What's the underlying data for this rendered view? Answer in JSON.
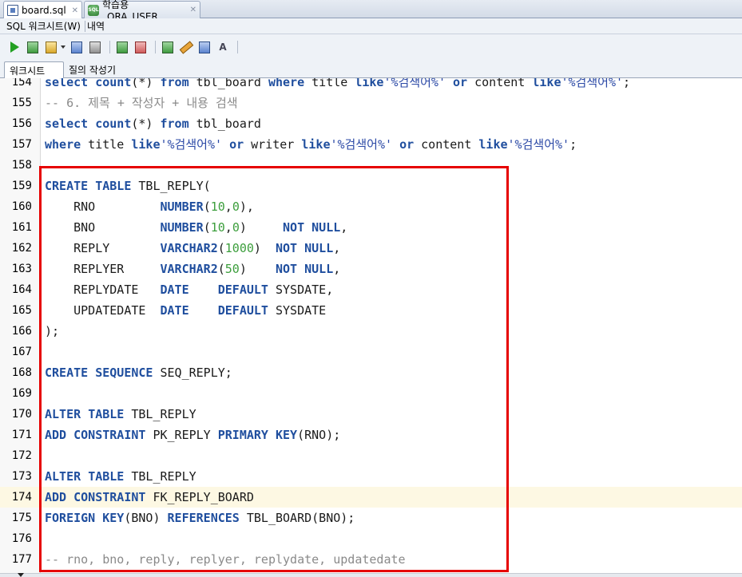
{
  "doc_tabs": [
    {
      "label": "board.sql",
      "icon": "sql-file-icon",
      "active": true
    },
    {
      "label": "학습용_ORA_USER",
      "icon": "database-connection-icon",
      "active": false
    }
  ],
  "menu": {
    "worksheet_label": "SQL 워크시트(W)",
    "history_label": "내역"
  },
  "toolbar_icons": [
    "run-statement-icon",
    "run-script-icon",
    "explain-plan-icon",
    "autotrace-icon",
    "sql-tuning-icon",
    "commit-icon",
    "rollback-icon",
    "unshared-sql-icon",
    "clear-icon",
    "history-icon",
    "format-icon"
  ],
  "sub_tabs": {
    "worksheet": "워크시트",
    "query_builder": "질의 작성기"
  },
  "editor": {
    "current_line": "174",
    "lines": [
      {
        "n": "154",
        "tokens": [
          [
            "kw",
            "select"
          ],
          [
            "pl",
            " "
          ],
          [
            "kw",
            "count"
          ],
          [
            "pl",
            "(*) "
          ],
          [
            "kw",
            "from"
          ],
          [
            "pl",
            " tbl_board "
          ],
          [
            "kw",
            "where"
          ],
          [
            "pl",
            " title "
          ],
          [
            "kw",
            "like"
          ],
          [
            "str",
            "'%검색어%'"
          ],
          [
            "pl",
            " "
          ],
          [
            "kw",
            "or"
          ],
          [
            "pl",
            " content "
          ],
          [
            "kw",
            "like"
          ],
          [
            "str",
            "'%검색어%'"
          ],
          [
            "pl",
            ";"
          ]
        ]
      },
      {
        "n": "155",
        "tokens": [
          [
            "cmt",
            "-- 6. 제목 + 작성자 + 내용 검색"
          ]
        ]
      },
      {
        "n": "156",
        "tokens": [
          [
            "kw",
            "select"
          ],
          [
            "pl",
            " "
          ],
          [
            "kw",
            "count"
          ],
          [
            "pl",
            "(*) "
          ],
          [
            "kw",
            "from"
          ],
          [
            "pl",
            " tbl_board"
          ]
        ]
      },
      {
        "n": "157",
        "tokens": [
          [
            "kw",
            "where"
          ],
          [
            "pl",
            " title "
          ],
          [
            "kw",
            "like"
          ],
          [
            "str",
            "'%검색어%'"
          ],
          [
            "pl",
            " "
          ],
          [
            "kw",
            "or"
          ],
          [
            "pl",
            " writer "
          ],
          [
            "kw",
            "like"
          ],
          [
            "str",
            "'%검색어%'"
          ],
          [
            "pl",
            " "
          ],
          [
            "kw",
            "or"
          ],
          [
            "pl",
            " content "
          ],
          [
            "kw",
            "like"
          ],
          [
            "str",
            "'%검색어%'"
          ],
          [
            "pl",
            ";"
          ]
        ]
      },
      {
        "n": "158",
        "tokens": []
      },
      {
        "n": "159",
        "tokens": [
          [
            "kw",
            "CREATE"
          ],
          [
            "pl",
            " "
          ],
          [
            "kw",
            "TABLE"
          ],
          [
            "pl",
            " TBL_REPLY("
          ]
        ]
      },
      {
        "n": "160",
        "tokens": [
          [
            "pl",
            "    RNO         "
          ],
          [
            "kw",
            "NUMBER"
          ],
          [
            "pl",
            "("
          ],
          [
            "num",
            "10"
          ],
          [
            "pl",
            ","
          ],
          [
            "num",
            "0"
          ],
          [
            "pl",
            "),"
          ]
        ]
      },
      {
        "n": "161",
        "tokens": [
          [
            "pl",
            "    BNO         "
          ],
          [
            "kw",
            "NUMBER"
          ],
          [
            "pl",
            "("
          ],
          [
            "num",
            "10"
          ],
          [
            "pl",
            ","
          ],
          [
            "num",
            "0"
          ],
          [
            "pl",
            ")     "
          ],
          [
            "kw",
            "NOT"
          ],
          [
            "pl",
            " "
          ],
          [
            "kw",
            "NULL"
          ],
          [
            "pl",
            ","
          ]
        ]
      },
      {
        "n": "162",
        "tokens": [
          [
            "pl",
            "    REPLY       "
          ],
          [
            "kw",
            "VARCHAR2"
          ],
          [
            "pl",
            "("
          ],
          [
            "num",
            "1000"
          ],
          [
            "pl",
            ")  "
          ],
          [
            "kw",
            "NOT"
          ],
          [
            "pl",
            " "
          ],
          [
            "kw",
            "NULL"
          ],
          [
            "pl",
            ","
          ]
        ]
      },
      {
        "n": "163",
        "tokens": [
          [
            "pl",
            "    REPLYER     "
          ],
          [
            "kw",
            "VARCHAR2"
          ],
          [
            "pl",
            "("
          ],
          [
            "num",
            "50"
          ],
          [
            "pl",
            ")    "
          ],
          [
            "kw",
            "NOT"
          ],
          [
            "pl",
            " "
          ],
          [
            "kw",
            "NULL"
          ],
          [
            "pl",
            ","
          ]
        ]
      },
      {
        "n": "164",
        "tokens": [
          [
            "pl",
            "    REPLYDATE   "
          ],
          [
            "kw",
            "DATE"
          ],
          [
            "pl",
            "    "
          ],
          [
            "kw",
            "DEFAULT"
          ],
          [
            "pl",
            " SYSDATE,"
          ]
        ]
      },
      {
        "n": "165",
        "tokens": [
          [
            "pl",
            "    UPDATEDATE  "
          ],
          [
            "kw",
            "DATE"
          ],
          [
            "pl",
            "    "
          ],
          [
            "kw",
            "DEFAULT"
          ],
          [
            "pl",
            " SYSDATE"
          ]
        ]
      },
      {
        "n": "166",
        "tokens": [
          [
            "pl",
            ");"
          ]
        ]
      },
      {
        "n": "167",
        "tokens": []
      },
      {
        "n": "168",
        "tokens": [
          [
            "kw",
            "CREATE"
          ],
          [
            "pl",
            " "
          ],
          [
            "kw",
            "SEQUENCE"
          ],
          [
            "pl",
            " SEQ_REPLY;"
          ]
        ]
      },
      {
        "n": "169",
        "tokens": []
      },
      {
        "n": "170",
        "tokens": [
          [
            "kw",
            "ALTER"
          ],
          [
            "pl",
            " "
          ],
          [
            "kw",
            "TABLE"
          ],
          [
            "pl",
            " TBL_REPLY"
          ]
        ]
      },
      {
        "n": "171",
        "tokens": [
          [
            "kw",
            "ADD"
          ],
          [
            "pl",
            " "
          ],
          [
            "kw",
            "CONSTRAINT"
          ],
          [
            "pl",
            " PK_REPLY "
          ],
          [
            "kw",
            "PRIMARY"
          ],
          [
            "pl",
            " "
          ],
          [
            "kw",
            "KEY"
          ],
          [
            "pl",
            "(RNO);"
          ]
        ]
      },
      {
        "n": "172",
        "tokens": []
      },
      {
        "n": "173",
        "tokens": [
          [
            "kw",
            "ALTER"
          ],
          [
            "pl",
            " "
          ],
          [
            "kw",
            "TABLE"
          ],
          [
            "pl",
            " TBL_REPLY"
          ]
        ]
      },
      {
        "n": "174",
        "tokens": [
          [
            "kw",
            "ADD"
          ],
          [
            "pl",
            " "
          ],
          [
            "kw",
            "CONSTRAINT"
          ],
          [
            "pl",
            " FK_REPLY_BOARD"
          ]
        ]
      },
      {
        "n": "175",
        "tokens": [
          [
            "kw",
            "FOREIGN"
          ],
          [
            "pl",
            " "
          ],
          [
            "kw",
            "KEY"
          ],
          [
            "pl",
            "(BNO) "
          ],
          [
            "kw",
            "REFERENCES"
          ],
          [
            "pl",
            " TBL_BOARD(BNO);"
          ]
        ]
      },
      {
        "n": "176",
        "tokens": []
      },
      {
        "n": "177",
        "tokens": [
          [
            "cmt",
            "-- rno, bno, reply, replyer, replydate, updatedate"
          ]
        ]
      }
    ]
  },
  "colors": {
    "keyword": "#1f4e9e",
    "number": "#3c9e3c",
    "string": "#2b49a6",
    "comment": "#8a8a8a",
    "highlight_box": "#e60000",
    "current_line": "#fdf8e3"
  }
}
